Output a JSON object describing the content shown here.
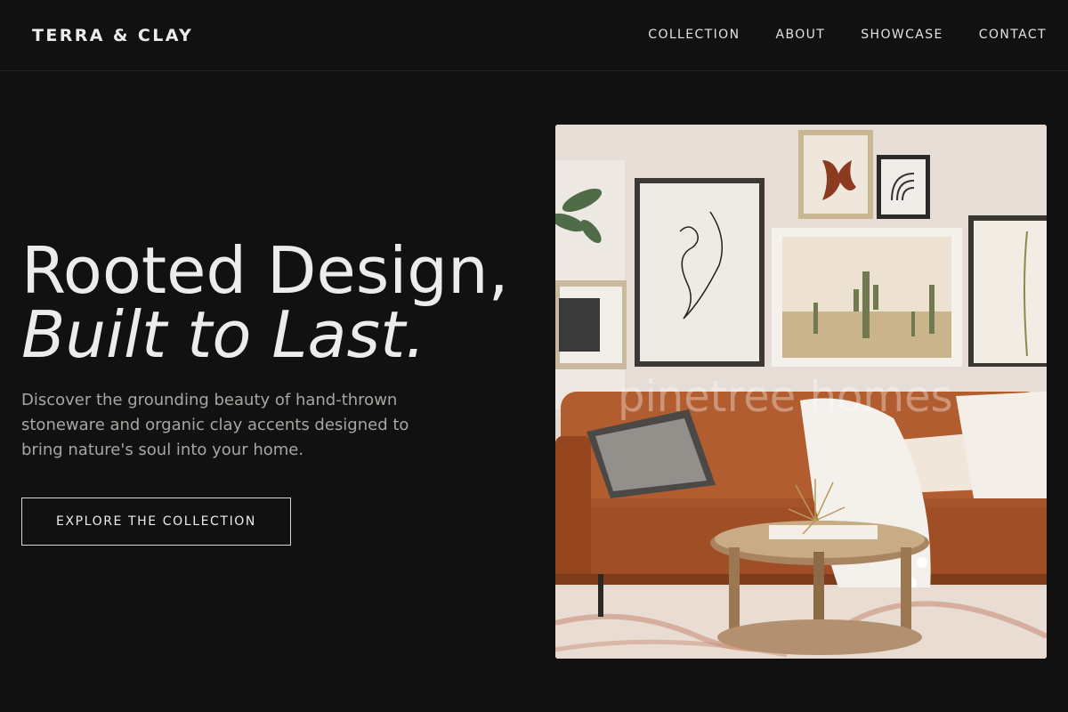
{
  "brand": {
    "name": "TERRA & CLAY"
  },
  "nav": {
    "items": [
      {
        "label": "COLLECTION"
      },
      {
        "label": "ABOUT"
      },
      {
        "label": "SHOWCASE"
      },
      {
        "label": "CONTACT"
      }
    ]
  },
  "hero": {
    "title_line1": "Rooted Design,",
    "title_line2": "Built to Last.",
    "description": "Discover the grounding beauty of hand-thrown stoneware and organic clay accents designed to bring nature's soul into your home.",
    "cta_label": "EXPLORE THE COLLECTION",
    "image": {
      "subject": "living room with leather sofa, gallery wall and round wooden coffee table",
      "watermark": "pinetree homes"
    }
  },
  "colors": {
    "background": "#111111",
    "text": "#ececec",
    "muted_text": "#a9a6a2",
    "leather": "#a5532a",
    "wall": "#e2d9d1"
  }
}
